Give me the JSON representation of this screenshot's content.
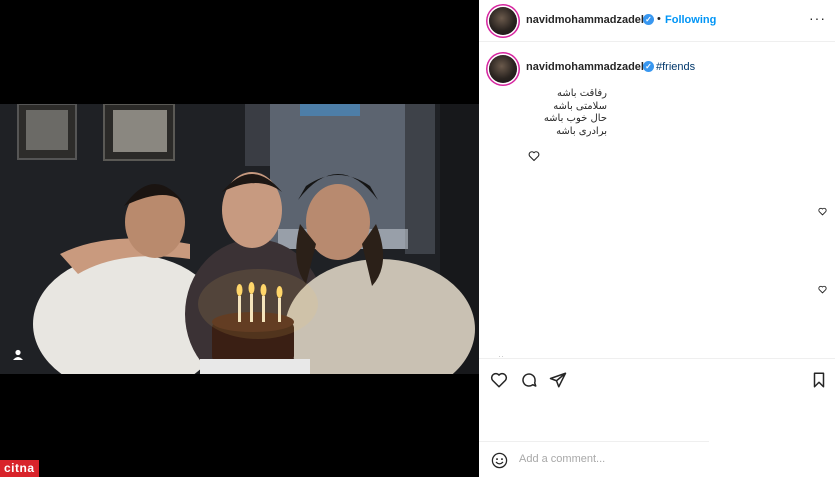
{
  "post": {
    "username": "navidmohammadzadeh",
    "follow_label": "Following",
    "separator": "•",
    "more_label": "···",
    "caption_hashtag": "#friends",
    "caption_lines": [
      "رفاقت باشه",
      "سلامتی باشه",
      "حال خوب باشه",
      "برادری باشه"
    ],
    "comment_placeholder": "Add a comment..."
  },
  "watermark": "citna",
  "icons": {
    "verified": "verified-badge-icon",
    "tag": "person-tag-icon",
    "heart": "heart-icon",
    "comment": "comment-icon",
    "share": "share-icon",
    "save": "bookmark-icon",
    "emoji": "emoji-icon",
    "more": "more-options-icon"
  },
  "colors": {
    "accent": "#0095f6",
    "verified": "#3897f0",
    "watermark_bg": "#d8232a",
    "hashtag": "#00376b"
  }
}
